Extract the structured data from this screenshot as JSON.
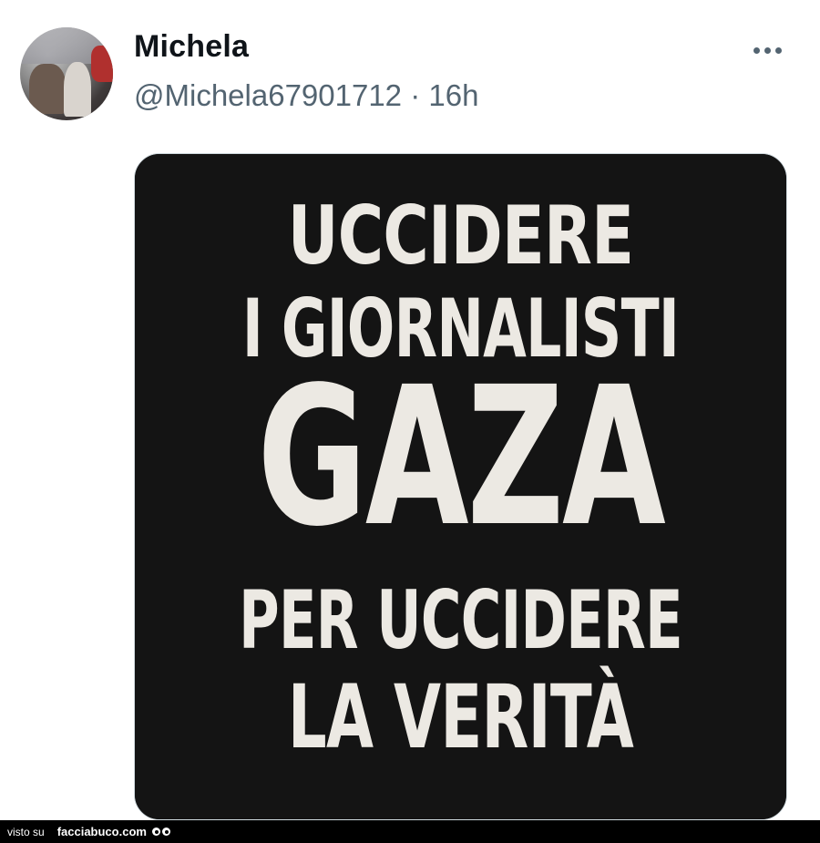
{
  "post": {
    "author_name": "Michela",
    "handle": "@Michela67901712",
    "separator": " · ",
    "time": "16h",
    "more_icon": "more-horizontal-icon"
  },
  "media": {
    "background_color": "#141414",
    "text_color": "#ece9e3",
    "lines": [
      "UCCIDERE",
      "I GIORNALISTI",
      "GAZA",
      "PER UCCIDERE",
      "LA VERITÀ"
    ]
  },
  "watermark": {
    "prefix": "visto su",
    "site": "facciabuco.com",
    "icon": "eyes-icon"
  }
}
